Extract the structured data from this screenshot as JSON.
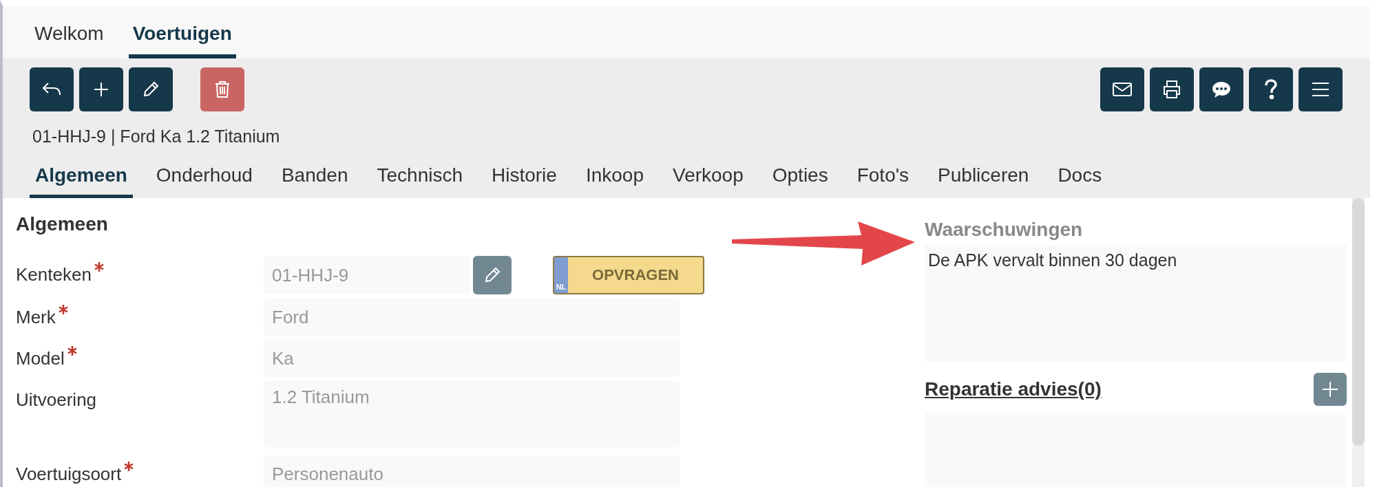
{
  "main_tabs": [
    {
      "label": "Welkom",
      "selected": false
    },
    {
      "label": "Voertuigen",
      "selected": true
    }
  ],
  "toolbar_left": [
    {
      "kind": "primary"
    },
    {
      "kind": "primary"
    },
    {
      "kind": "primary"
    },
    {
      "kind": "danger"
    }
  ],
  "record_title": "01-HHJ-9 | Ford Ka 1.2 Titanium",
  "sub_tabs": [
    {
      "label": "Algemeen",
      "selected": true
    },
    {
      "label": "Onderhoud",
      "selected": false
    },
    {
      "label": "Banden",
      "selected": false
    },
    {
      "label": "Technisch",
      "selected": false
    },
    {
      "label": "Historie",
      "selected": false
    },
    {
      "label": "Inkoop",
      "selected": false
    },
    {
      "label": "Verkoop",
      "selected": false
    },
    {
      "label": "Opties",
      "selected": false
    },
    {
      "label": "Foto's",
      "selected": false
    },
    {
      "label": "Publiceren",
      "selected": false
    },
    {
      "label": "Docs",
      "selected": false
    }
  ],
  "section_title": "Algemeen",
  "fields": [
    {
      "label": "Kenteken",
      "required": true,
      "value": "01-HHJ-9",
      "kind": "plate",
      "lookup_button": "OPVRAGEN",
      "plate_country": "NL"
    },
    {
      "label": "Merk",
      "required": true,
      "value": "Ford",
      "kind": "text"
    },
    {
      "label": "Model",
      "required": true,
      "value": "Ka",
      "kind": "text"
    },
    {
      "label": "Uitvoering",
      "required": false,
      "value": "1.2 Titanium",
      "kind": "textarea"
    },
    {
      "label": "Voertuigsoort",
      "required": true,
      "value": "Personenauto",
      "kind": "select"
    }
  ],
  "warnings": {
    "title": "Waarschuwingen",
    "text": "De APK vervalt binnen 30 dagen"
  },
  "repair_advice": {
    "title": "Reparatie advies(0)"
  }
}
